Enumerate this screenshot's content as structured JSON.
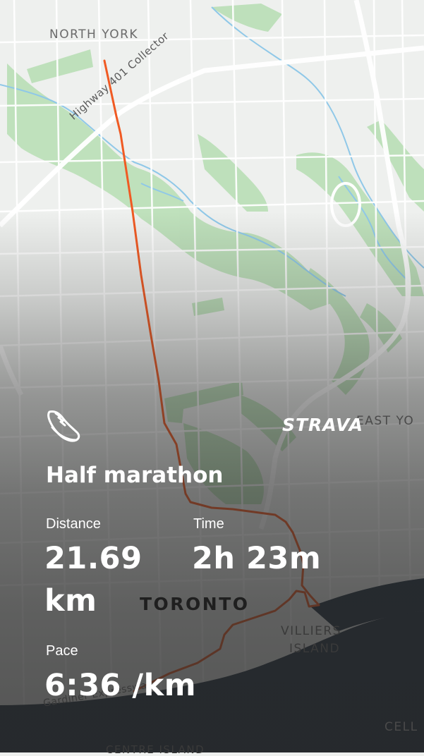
{
  "map": {
    "labels": {
      "north_york": "NORTH YORK",
      "highway": "Highway 401 Collector",
      "east_york": "EAST YO",
      "toronto": "TORONTO",
      "villiers_1": "VILLIERS",
      "villiers_2": "ISLAND",
      "cell": "CELL",
      "centre_island": "CENTRE ISLAND",
      "gardiner": "Gardiner Expressway"
    },
    "colors": {
      "land": "#eef0ee",
      "park": "#b9dfb6",
      "road": "#ffffff",
      "river": "#8fc8e8",
      "water": "#1f2e3e",
      "route": "#f05a23"
    }
  },
  "brand": {
    "logo_text": "STRAVA"
  },
  "activity": {
    "icon": "running-shoe-icon",
    "title": "Half marathon",
    "distance": {
      "label": "Distance",
      "value": "21.69 km"
    },
    "time": {
      "label": "Time",
      "value": "2h 23m"
    },
    "pace": {
      "label": "Pace",
      "value": "6:36 /km"
    }
  }
}
